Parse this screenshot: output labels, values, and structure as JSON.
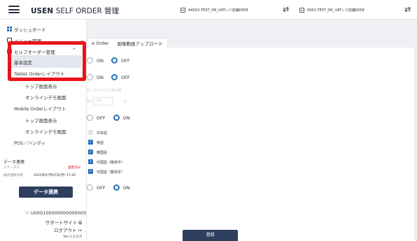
{
  "header": {
    "brand": "USEN",
    "title": "SELF ORDER 管理",
    "store_left": "A402X:TEST_OR_UATレジ店舗0058",
    "store_right": "0001:TEST_OR_UATレジ店舗0058",
    "icons": [
      "hamburger-menu-icon",
      "store-icon",
      "swap-arrows-icon"
    ]
  },
  "sidebar": {
    "dashboard": "ダッシュボード",
    "menu_mgmt": "メニュー管理",
    "self_order_mgmt": "セルフオーダー管理",
    "sub": {
      "basic": "基本設定",
      "tablet_layout": "Tablet Orderレイアウト",
      "top_display_1": "トップ画面表示",
      "online_demo_1": "オンラインデモ画面",
      "mobile_layout": "Mobile Orderレイアウト",
      "top_display_2": "トップ画面表示",
      "online_demo_2": "オンラインデモ画面",
      "pos_handy": "POS／ハンディ"
    },
    "data_sync": {
      "title": "データ連携",
      "status_label": "ステータス",
      "status_value": "連携済み",
      "last_label": "最終連携日時",
      "last_value": "2025年07月07日(月) 17:26",
      "button": "データ連携"
    },
    "user": {
      "id": "U0001000000000000055",
      "support": "サポートサイト",
      "logout": "ログアウト",
      "version": "Ver.1.2.0.0"
    }
  },
  "main": {
    "tab_order": "e Order",
    "tab_image": "画像動画アップロード",
    "rows": [
      {
        "a": "ON",
        "b": "OFF",
        "selected": "b"
      },
      {
        "a": "ON",
        "b": "OFF",
        "selected": "b"
      },
      {
        "a": "OFF",
        "b": "ON",
        "selected": "b"
      },
      {
        "a": "OFF",
        "b": "ON",
        "selected": "b"
      }
    ],
    "faint_label": "おこわりボタン表示数",
    "faint_prefix": "残り",
    "faint_value": "50",
    "faint_unit": "点",
    "languages": [
      {
        "label": "日本語",
        "checked": false
      },
      {
        "label": "英語",
        "checked": true
      },
      {
        "label": "韓国語",
        "checked": true
      },
      {
        "label": "中国語（簡体字）",
        "checked": true
      },
      {
        "label": "中国語（繁体字）",
        "checked": true
      }
    ],
    "submit": "登録",
    "colors": {
      "accent": "#2c6eb5",
      "navy": "#2d3e5e",
      "highlight": "#e8141b"
    }
  }
}
